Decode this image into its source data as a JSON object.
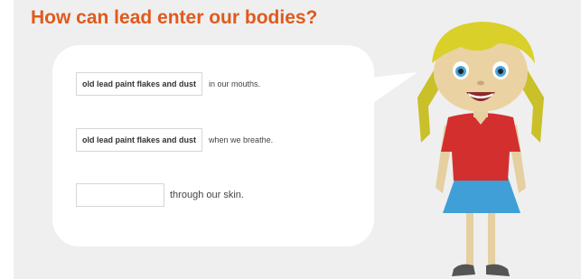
{
  "title": "How can lead enter our bodies?",
  "rows": [
    {
      "answer": "old lead paint flakes and dust",
      "suffix": "in our mouths."
    },
    {
      "answer": "old lead paint flakes and dust",
      "suffix": "when we breathe."
    },
    {
      "answer": "",
      "suffix": "through our skin."
    }
  ],
  "colors": {
    "title": "#e05a1c",
    "panel": "#efefef",
    "shirt": "#d32f2f",
    "skirt": "#3f9fd6",
    "hair": "#d9d02a"
  }
}
